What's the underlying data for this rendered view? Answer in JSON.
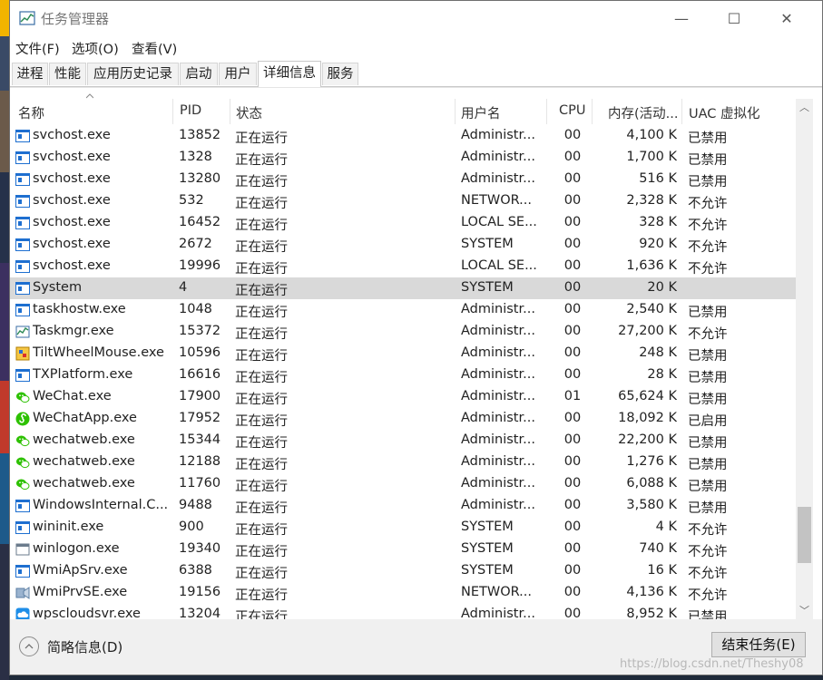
{
  "window": {
    "title": "任务管理器"
  },
  "window_controls": {
    "minimize": "—",
    "maximize": "☐",
    "close": "✕"
  },
  "menu": [
    "文件(F)",
    "选项(O)",
    "查看(V)"
  ],
  "tabs": [
    "进程",
    "性能",
    "应用历史记录",
    "启动",
    "用户",
    "详细信息",
    "服务"
  ],
  "active_tab": "详细信息",
  "columns": [
    "名称",
    "PID",
    "状态",
    "用户名",
    "CPU",
    "内存(活动...",
    "UAC 虚拟化"
  ],
  "rows": [
    {
      "name": "svchost.exe",
      "pid": "13852",
      "status": "正在运行",
      "user": "Administr...",
      "cpu": "00",
      "mem": "4,100 K",
      "uac": "已禁用",
      "icon": "service-icon"
    },
    {
      "name": "svchost.exe",
      "pid": "1328",
      "status": "正在运行",
      "user": "Administr...",
      "cpu": "00",
      "mem": "1,700 K",
      "uac": "已禁用",
      "icon": "service-icon"
    },
    {
      "name": "svchost.exe",
      "pid": "13280",
      "status": "正在运行",
      "user": "Administr...",
      "cpu": "00",
      "mem": "516 K",
      "uac": "已禁用",
      "icon": "service-icon"
    },
    {
      "name": "svchost.exe",
      "pid": "532",
      "status": "正在运行",
      "user": "NETWOR...",
      "cpu": "00",
      "mem": "2,328 K",
      "uac": "不允许",
      "icon": "service-icon"
    },
    {
      "name": "svchost.exe",
      "pid": "16452",
      "status": "正在运行",
      "user": "LOCAL SE...",
      "cpu": "00",
      "mem": "328 K",
      "uac": "不允许",
      "icon": "service-icon"
    },
    {
      "name": "svchost.exe",
      "pid": "2672",
      "status": "正在运行",
      "user": "SYSTEM",
      "cpu": "00",
      "mem": "920 K",
      "uac": "不允许",
      "icon": "service-icon"
    },
    {
      "name": "svchost.exe",
      "pid": "19996",
      "status": "正在运行",
      "user": "LOCAL SE...",
      "cpu": "00",
      "mem": "1,636 K",
      "uac": "不允许",
      "icon": "service-icon"
    },
    {
      "name": "System",
      "pid": "4",
      "status": "正在运行",
      "user": "SYSTEM",
      "cpu": "00",
      "mem": "20 K",
      "uac": "",
      "icon": "service-icon"
    },
    {
      "name": "taskhostw.exe",
      "pid": "1048",
      "status": "正在运行",
      "user": "Administr...",
      "cpu": "00",
      "mem": "2,540 K",
      "uac": "已禁用",
      "icon": "service-icon"
    },
    {
      "name": "Taskmgr.exe",
      "pid": "15372",
      "status": "正在运行",
      "user": "Administr...",
      "cpu": "00",
      "mem": "27,200 K",
      "uac": "不允许",
      "icon": "taskmgr-icon"
    },
    {
      "name": "TiltWheelMouse.exe",
      "pid": "10596",
      "status": "正在运行",
      "user": "Administr...",
      "cpu": "00",
      "mem": "248 K",
      "uac": "已禁用",
      "icon": "mouse-app-icon"
    },
    {
      "name": "TXPlatform.exe",
      "pid": "16616",
      "status": "正在运行",
      "user": "Administr...",
      "cpu": "00",
      "mem": "28 K",
      "uac": "已禁用",
      "icon": "service-icon"
    },
    {
      "name": "WeChat.exe",
      "pid": "17900",
      "status": "正在运行",
      "user": "Administr...",
      "cpu": "01",
      "mem": "65,624 K",
      "uac": "已禁用",
      "icon": "wechat-icon"
    },
    {
      "name": "WeChatApp.exe",
      "pid": "17952",
      "status": "正在运行",
      "user": "Administr...",
      "cpu": "00",
      "mem": "18,092 K",
      "uac": "已启用",
      "icon": "miniprogram-icon"
    },
    {
      "name": "wechatweb.exe",
      "pid": "15344",
      "status": "正在运行",
      "user": "Administr...",
      "cpu": "00",
      "mem": "22,200 K",
      "uac": "已禁用",
      "icon": "wechat-icon"
    },
    {
      "name": "wechatweb.exe",
      "pid": "12188",
      "status": "正在运行",
      "user": "Administr...",
      "cpu": "00",
      "mem": "1,276 K",
      "uac": "已禁用",
      "icon": "wechat-icon"
    },
    {
      "name": "wechatweb.exe",
      "pid": "11760",
      "status": "正在运行",
      "user": "Administr...",
      "cpu": "00",
      "mem": "6,088 K",
      "uac": "已禁用",
      "icon": "wechat-icon"
    },
    {
      "name": "WindowsInternal.C...",
      "pid": "9488",
      "status": "正在运行",
      "user": "Administr...",
      "cpu": "00",
      "mem": "3,580 K",
      "uac": "已禁用",
      "icon": "service-icon"
    },
    {
      "name": "wininit.exe",
      "pid": "900",
      "status": "正在运行",
      "user": "SYSTEM",
      "cpu": "00",
      "mem": "4 K",
      "uac": "不允许",
      "icon": "service-icon"
    },
    {
      "name": "winlogon.exe",
      "pid": "19340",
      "status": "正在运行",
      "user": "SYSTEM",
      "cpu": "00",
      "mem": "740 K",
      "uac": "不允许",
      "icon": "window-app-icon"
    },
    {
      "name": "WmiApSrv.exe",
      "pid": "6388",
      "status": "正在运行",
      "user": "SYSTEM",
      "cpu": "00",
      "mem": "16 K",
      "uac": "不允许",
      "icon": "service-icon"
    },
    {
      "name": "WmiPrvSE.exe",
      "pid": "19156",
      "status": "正在运行",
      "user": "NETWOR...",
      "cpu": "00",
      "mem": "4,136 K",
      "uac": "不允许",
      "icon": "wmi-icon"
    },
    {
      "name": "wpscloudsvr.exe",
      "pid": "13204",
      "status": "正在运行",
      "user": "Administr...",
      "cpu": "00",
      "mem": "8,952 K",
      "uac": "已禁用",
      "icon": "cloud-icon"
    }
  ],
  "selected_row": "System",
  "footer": {
    "fewer_details": "简略信息(D)",
    "end_task": "结束任务(E)"
  },
  "watermark": "https://blog.csdn.net/Theshy08",
  "colors": {
    "selection": "#d9d9d9",
    "window_bg": "#ffffff",
    "footer_bg": "#f0f0f0",
    "service_icon_blue": "#1e6fd0",
    "wechat_green": "#2dc100"
  }
}
